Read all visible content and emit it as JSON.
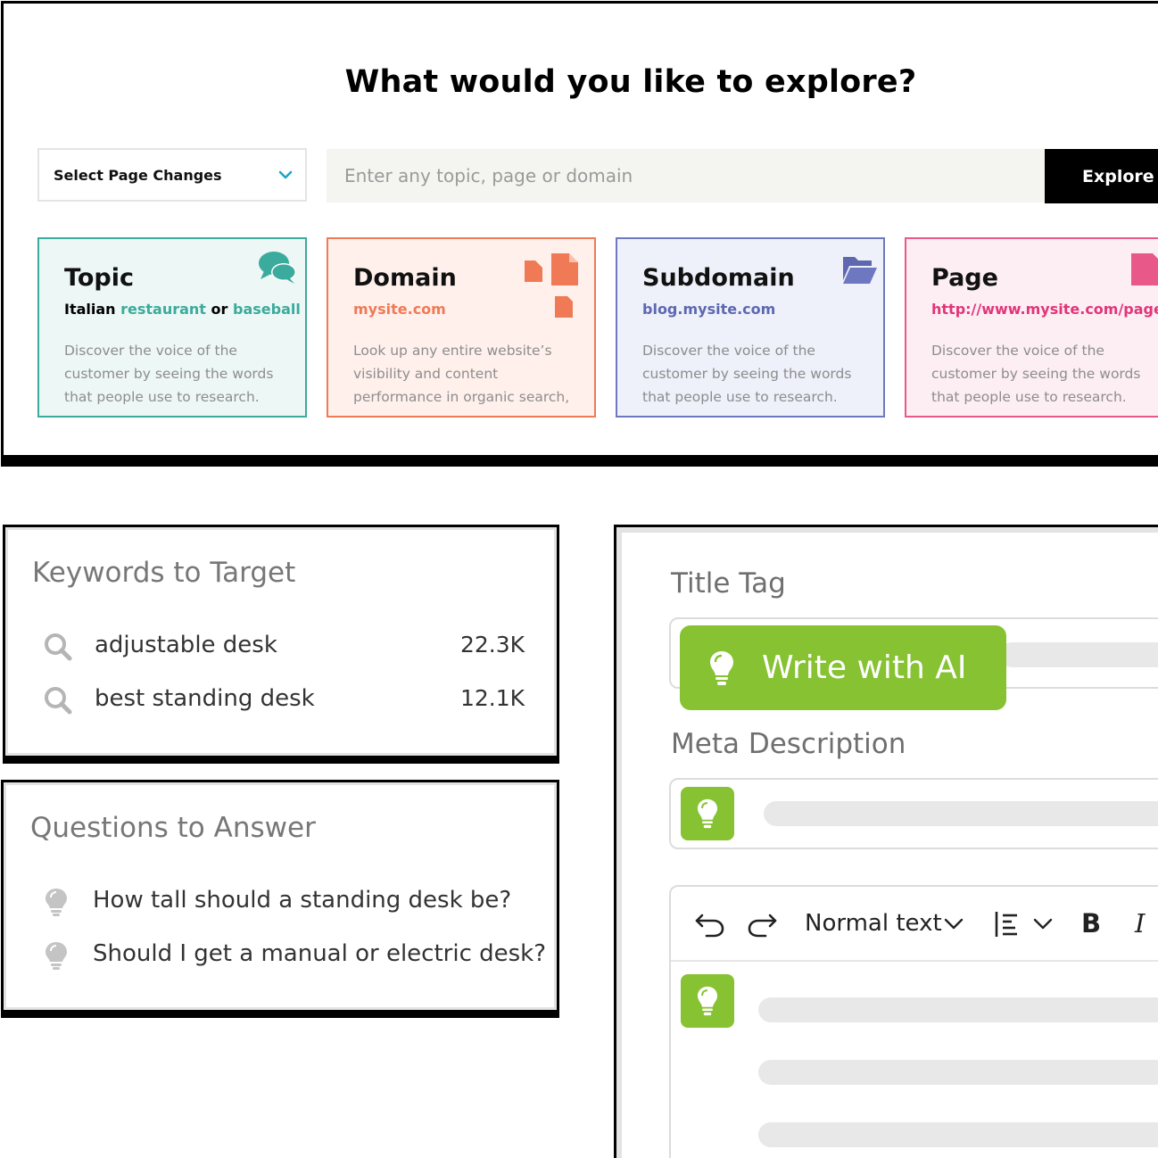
{
  "explore": {
    "title": "What would you like to explore?",
    "select_label": "Select Page Changes",
    "search_placeholder": "Enter any topic, page or domain",
    "explore_button": "Explore",
    "cards": [
      {
        "title": "Topic",
        "sub_parts": [
          "Italian ",
          "restaurant",
          " or ",
          "baseball"
        ],
        "desc": "Discover the voice of the customer by seeing the words that people use to research.",
        "icon": "chat-bubbles-icon",
        "color": "#3aab9c"
      },
      {
        "title": "Domain",
        "sub": "mysite.com",
        "desc": "Look up any entire website’s visibility and content performance in organic search,",
        "icon": "documents-icon",
        "color": "#f07a55"
      },
      {
        "title": "Subdomain",
        "sub": "blog.mysite.com",
        "desc": "Discover the voice of the customer by seeing the words that people use to research.",
        "icon": "folder-icon",
        "color": "#6e78c0"
      },
      {
        "title": "Page",
        "sub": "http://www.mysite.com/page.html",
        "desc": "Discover the voice of the customer by seeing the words that people use to research.",
        "icon": "document-icon",
        "color": "#e8598a"
      }
    ]
  },
  "keywords": {
    "title": "Keywords to Target",
    "items": [
      {
        "text": "adjustable desk",
        "volume": "22.3K"
      },
      {
        "text": "best standing desk",
        "volume": "12.1K"
      }
    ]
  },
  "questions": {
    "title": "Questions to Answer",
    "items": [
      {
        "text": "How tall should a standing desk be?"
      },
      {
        "text": "Should I get a manual or electric desk?"
      }
    ]
  },
  "editor": {
    "title_tag_label": "Title Tag",
    "write_ai_label": "Write with AI",
    "meta_label": "Meta Description",
    "toolbar": {
      "text_style": "Normal text",
      "bold": "B",
      "italic": "I"
    },
    "accent_color": "#86c232"
  }
}
